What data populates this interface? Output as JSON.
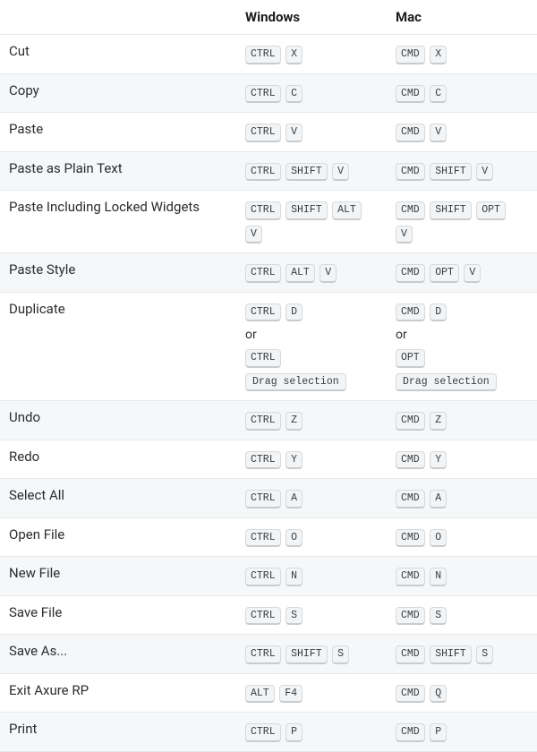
{
  "headers": {
    "action": "",
    "windows": "Windows",
    "mac": "Mac"
  },
  "or_label": "or",
  "rows": [
    {
      "action": "Cut",
      "win": [
        [
          "CTRL",
          "X"
        ]
      ],
      "mac": [
        [
          "CMD",
          "X"
        ]
      ]
    },
    {
      "action": "Copy",
      "win": [
        [
          "CTRL",
          "C"
        ]
      ],
      "mac": [
        [
          "CMD",
          "C"
        ]
      ]
    },
    {
      "action": "Paste",
      "win": [
        [
          "CTRL",
          "V"
        ]
      ],
      "mac": [
        [
          "CMD",
          "V"
        ]
      ]
    },
    {
      "action": "Paste as Plain Text",
      "win": [
        [
          "CTRL",
          "SHIFT",
          "V"
        ]
      ],
      "mac": [
        [
          "CMD",
          "SHIFT",
          "V"
        ]
      ]
    },
    {
      "action": "Paste Including Locked Widgets",
      "win": [
        [
          "CTRL",
          "SHIFT",
          "ALT",
          "V"
        ]
      ],
      "mac": [
        [
          "CMD",
          "SHIFT",
          "OPT",
          "V"
        ]
      ]
    },
    {
      "action": "Paste Style",
      "win": [
        [
          "CTRL",
          "ALT",
          "V"
        ]
      ],
      "mac": [
        [
          "CMD",
          "OPT",
          "V"
        ]
      ]
    },
    {
      "action": "Duplicate",
      "win": [
        [
          "CTRL",
          "D"
        ],
        [
          "CTRL",
          "Drag selection"
        ]
      ],
      "mac": [
        [
          "CMD",
          "D"
        ],
        [
          "OPT",
          "Drag selection"
        ]
      ]
    },
    {
      "action": "Undo",
      "win": [
        [
          "CTRL",
          "Z"
        ]
      ],
      "mac": [
        [
          "CMD",
          "Z"
        ]
      ]
    },
    {
      "action": "Redo",
      "win": [
        [
          "CTRL",
          "Y"
        ]
      ],
      "mac": [
        [
          "CMD",
          "Y"
        ]
      ]
    },
    {
      "action": "Select All",
      "win": [
        [
          "CTRL",
          "A"
        ]
      ],
      "mac": [
        [
          "CMD",
          "A"
        ]
      ]
    },
    {
      "action": "Open File",
      "win": [
        [
          "CTRL",
          "O"
        ]
      ],
      "mac": [
        [
          "CMD",
          "O"
        ]
      ]
    },
    {
      "action": "New File",
      "win": [
        [
          "CTRL",
          "N"
        ]
      ],
      "mac": [
        [
          "CMD",
          "N"
        ]
      ]
    },
    {
      "action": "Save File",
      "win": [
        [
          "CTRL",
          "S"
        ]
      ],
      "mac": [
        [
          "CMD",
          "S"
        ]
      ]
    },
    {
      "action": "Save As...",
      "win": [
        [
          "CTRL",
          "SHIFT",
          "S"
        ]
      ],
      "mac": [
        [
          "CMD",
          "SHIFT",
          "S"
        ]
      ]
    },
    {
      "action": "Exit Axure RP",
      "win": [
        [
          "ALT",
          "F4"
        ]
      ],
      "mac": [
        [
          "CMD",
          "Q"
        ]
      ]
    },
    {
      "action": "Print",
      "win": [
        [
          "CTRL",
          "P"
        ]
      ],
      "mac": [
        [
          "CMD",
          "P"
        ]
      ]
    }
  ]
}
